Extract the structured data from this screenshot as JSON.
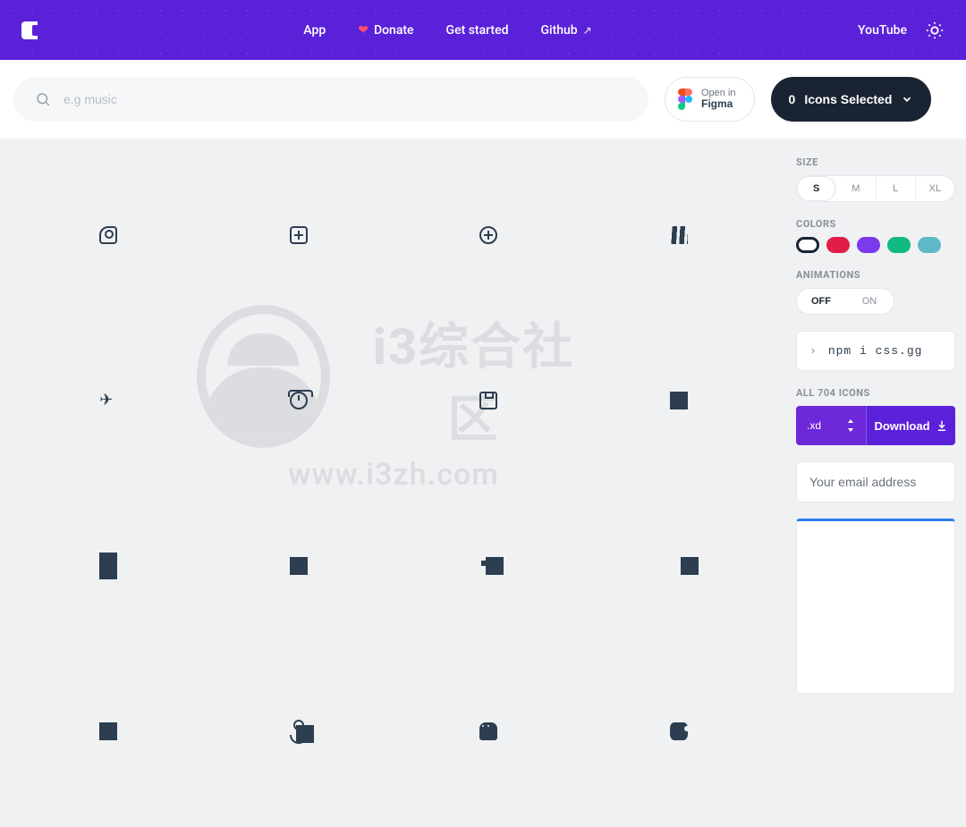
{
  "header": {
    "nav": {
      "app": "App",
      "donate": "Donate",
      "get_started": "Get started",
      "github": "Github"
    },
    "right": {
      "youtube": "YouTube"
    }
  },
  "toolbar": {
    "search_placeholder": "e.g music",
    "figma": {
      "line1": "Open in",
      "line2": "Figma"
    },
    "selected": {
      "count": "0",
      "label": "Icons Selected"
    }
  },
  "sidebar": {
    "size_label": "SIZE",
    "sizes": [
      "S",
      "M",
      "L",
      "XL"
    ],
    "size_active_index": 0,
    "colors_label": "COLORS",
    "colors": [
      "#1a2332",
      "#e11d48",
      "#7c3aed",
      "#10b981",
      "#5eb8c7"
    ],
    "anim_label": "ANIMATIONS",
    "anim": {
      "off": "OFF",
      "on": "ON",
      "active": "off"
    },
    "npm_cmd": "npm i css.gg",
    "all_icons_label": "ALL 704 ICONS",
    "format": ".xd",
    "download": "Download",
    "email_placeholder": "Your email address"
  },
  "icons": [
    "abstract",
    "add",
    "add-r",
    "adidas",
    "airplane",
    "alarm",
    "album",
    "align-bottom",
    "align-center",
    "align-left",
    "align-middle",
    "align-right",
    "align-top",
    "anchor",
    "android",
    "apple"
  ],
  "watermark": {
    "title": "i3综合社区",
    "url": "www.i3zh.com"
  }
}
